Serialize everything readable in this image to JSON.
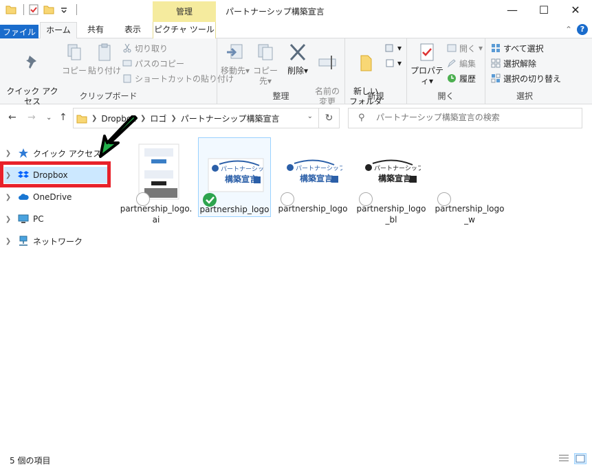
{
  "window": {
    "title": "パートナーシップ構築宣言",
    "context_tab_header": "管理"
  },
  "ribbon_tabs": {
    "file": "ファイル",
    "home": "ホーム",
    "share": "共有",
    "view": "表示",
    "picture_tools": "ピクチャ ツール"
  },
  "clipboard": {
    "pin": "クイック アクセス\nにピン留めする",
    "copy": "コピー",
    "paste": "貼り付け",
    "cut": "切り取り",
    "copy_path": "パスのコピー",
    "paste_shortcut": "ショートカットの貼り付け",
    "label": "クリップボード"
  },
  "organize": {
    "move_to": "移動先",
    "copy_to": "コピー先",
    "delete": "削除",
    "rename": "名前の\n変更",
    "label": "整理"
  },
  "new": {
    "new_folder": "新しい\nフォルダー",
    "label": "新規"
  },
  "open": {
    "properties": "プロパティ",
    "open": "開く",
    "edit": "編集",
    "history": "履歴",
    "label": "開く"
  },
  "select": {
    "select_all": "すべて選択",
    "select_none": "選択解除",
    "invert": "選択の切り替え",
    "label": "選択"
  },
  "address": {
    "crumbs": [
      "Dropbox",
      "ロゴ",
      "パートナーシップ構築宣言"
    ]
  },
  "search": {
    "placeholder": "パートナーシップ構築宣言の検索"
  },
  "nav_pane": {
    "items": [
      {
        "label": "クイック アクセス",
        "icon": "star-icon"
      },
      {
        "label": "Dropbox",
        "icon": "dropbox-icon"
      },
      {
        "label": "OneDrive",
        "icon": "cloud-icon"
      },
      {
        "label": "PC",
        "icon": "monitor-icon"
      },
      {
        "label": "ネットワーク",
        "icon": "network-icon"
      }
    ]
  },
  "files": [
    {
      "name": "partnership_logo.\nai",
      "status": "cloud"
    },
    {
      "name": "partnership_logo",
      "status": "synced"
    },
    {
      "name": "partnership_logo",
      "status": "cloud"
    },
    {
      "name": "partnership_logo\n_bl",
      "status": "cloud"
    },
    {
      "name": "partnership_logo\n_w",
      "status": "cloud"
    }
  ],
  "logo_text": {
    "line1": "パートナーシップ",
    "line2": "構築宣言"
  },
  "status_bar": {
    "count": "5 個の項目"
  },
  "colors": {
    "accent": "#1a6ccc",
    "context_tab": "#f5eb9e",
    "selection": "#cce8ff",
    "highlight_box": "#e8212a",
    "arrow": "#22b04a"
  }
}
